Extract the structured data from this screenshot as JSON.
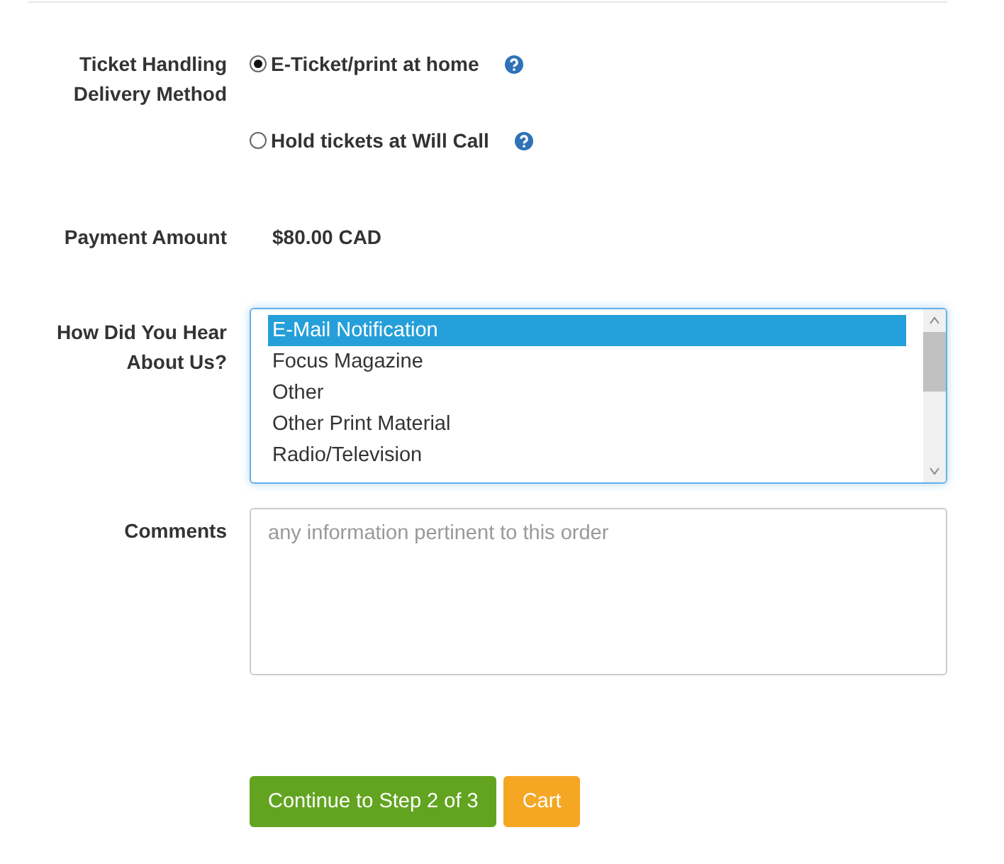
{
  "delivery": {
    "label": "Ticket Handling Delivery Method",
    "options": [
      {
        "label": "E-Ticket/print at home",
        "selected": true
      },
      {
        "label": "Hold tickets at Will Call",
        "selected": false
      }
    ]
  },
  "payment": {
    "label": "Payment Amount",
    "value": "$80.00 CAD"
  },
  "referral": {
    "label": "How Did You Hear About Us?",
    "options": [
      {
        "label": "E-Mail Notification",
        "selected": true
      },
      {
        "label": "Focus Magazine",
        "selected": false
      },
      {
        "label": "Other",
        "selected": false
      },
      {
        "label": "Other Print Material",
        "selected": false
      },
      {
        "label": "Radio/Television",
        "selected": false
      }
    ]
  },
  "comments": {
    "label": "Comments",
    "placeholder": "any information pertinent to this order"
  },
  "buttons": [
    {
      "label": "Continue to Step 2 of 3",
      "kind": "primary"
    },
    {
      "label": "Cart",
      "kind": "secondary"
    }
  ]
}
